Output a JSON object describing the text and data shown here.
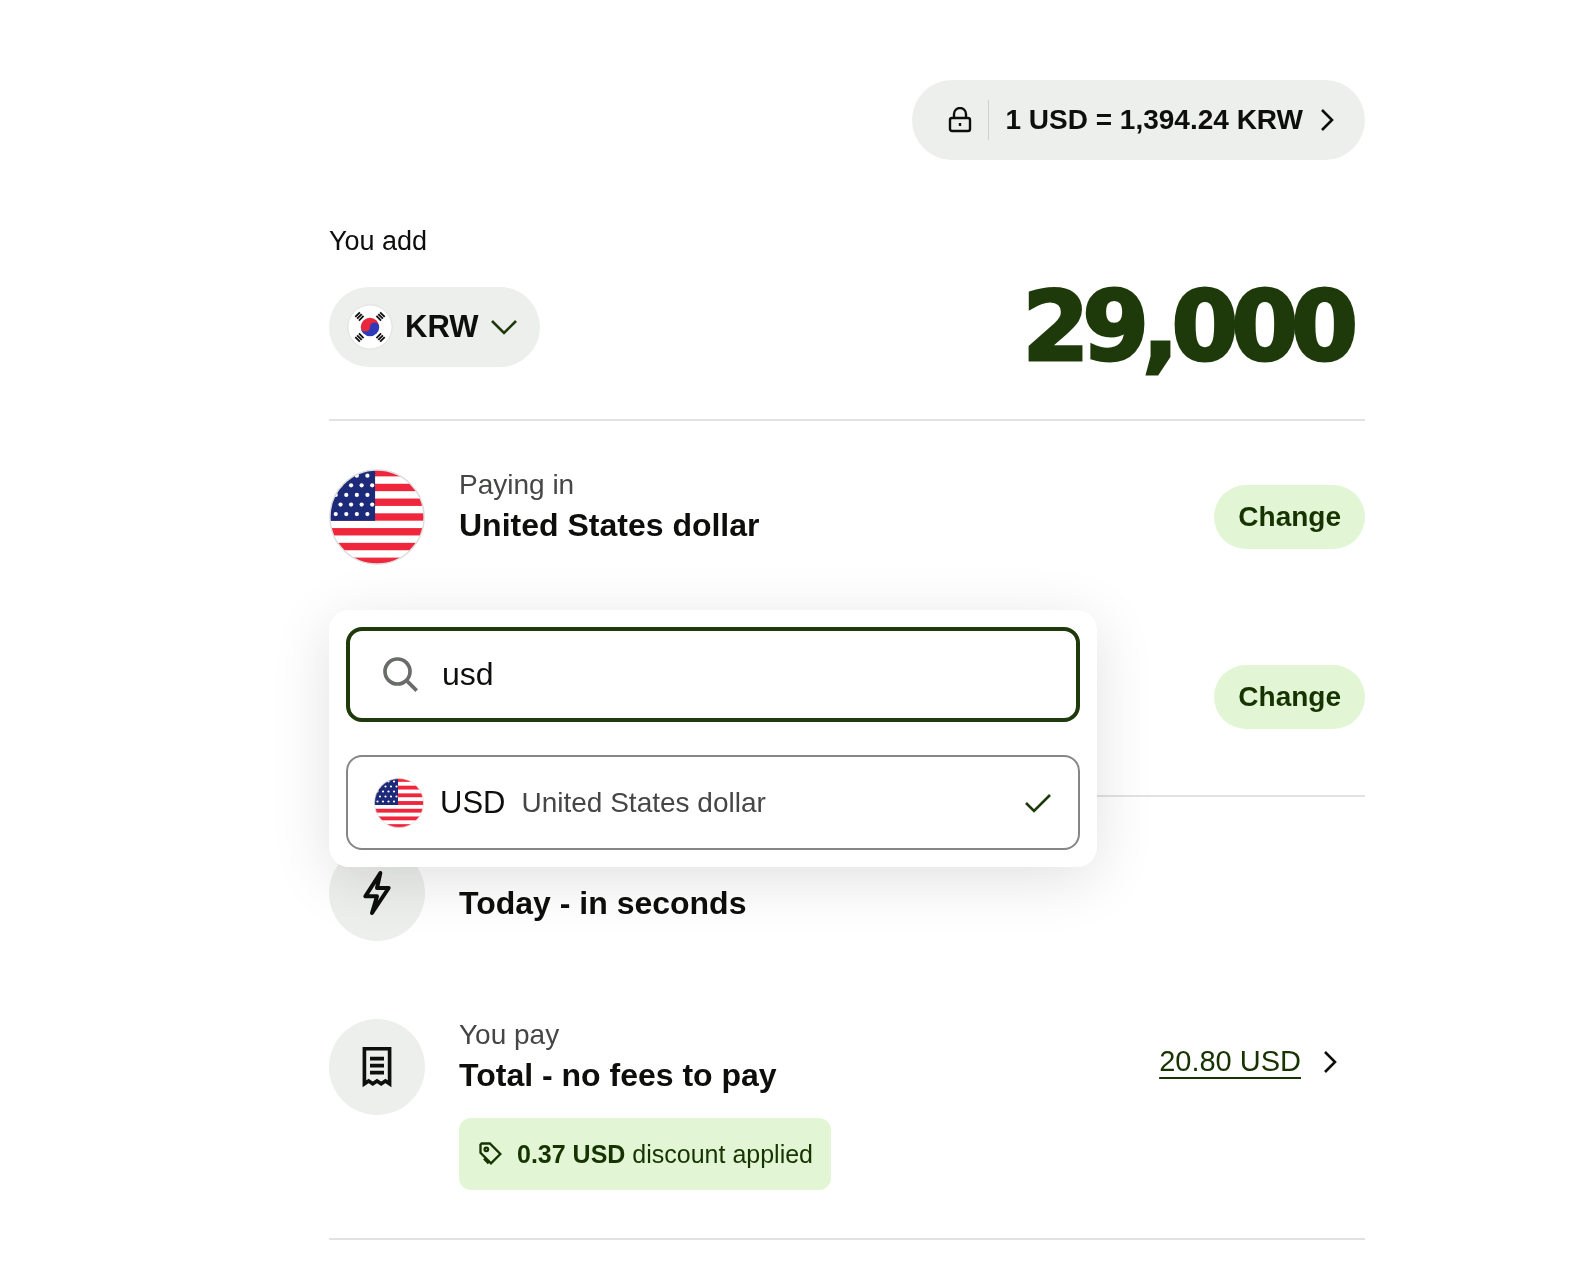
{
  "rate_pill": {
    "text": "1 USD = 1,394.24 KRW"
  },
  "you_add": {
    "label": "You add",
    "currency": "KRW",
    "amount": "29,000"
  },
  "rows": [
    {
      "kind": "flag",
      "label": "Paying in",
      "value": "United States dollar",
      "action": "Change"
    },
    {
      "kind": "hidden",
      "action": "Change"
    },
    {
      "kind": "bolt",
      "value": "Today - in seconds"
    },
    {
      "kind": "receipt",
      "label": "You pay",
      "value": "Total - no fees to pay",
      "amount": "20.80 USD",
      "badge": {
        "amount": "0.37 USD",
        "text": "discount applied"
      }
    }
  ],
  "dropdown": {
    "search_value": "usd",
    "options": [
      {
        "code": "USD",
        "name": "United States dollar",
        "selected": true
      }
    ]
  }
}
